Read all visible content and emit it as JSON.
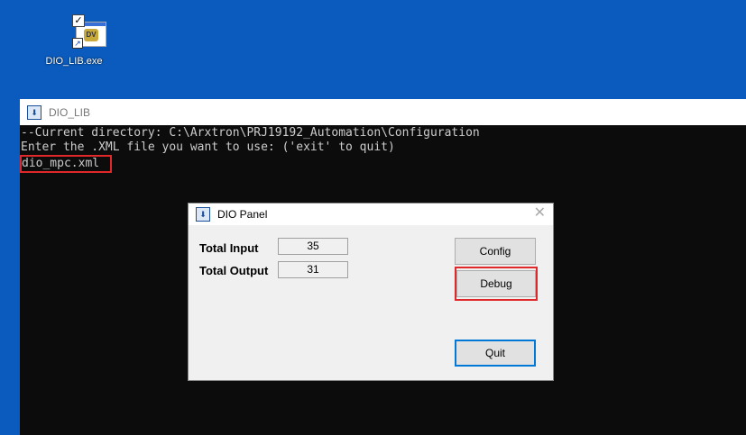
{
  "desktop": {
    "icon_label": "DIO_LIB.exe"
  },
  "console": {
    "title": "DIO_LIB",
    "lines": [
      "--Current directory: C:\\Arxtron\\PRJ19192_Automation\\Configuration",
      "Enter the .XML file you want to use: ('exit' to quit)"
    ],
    "input_value": "dio_mpc.xml"
  },
  "dialog": {
    "title": "DIO Panel",
    "total_input_label": "Total Input",
    "total_input_value": "35",
    "total_output_label": "Total Output",
    "total_output_value": "31",
    "config_label": "Config",
    "debug_label": "Debug",
    "quit_label": "Quit"
  },
  "colors": {
    "desktop_bg": "#0a5bbd",
    "console_bg": "#0c0c0c",
    "highlight": "#e0282a",
    "focus_border": "#0078d7"
  }
}
